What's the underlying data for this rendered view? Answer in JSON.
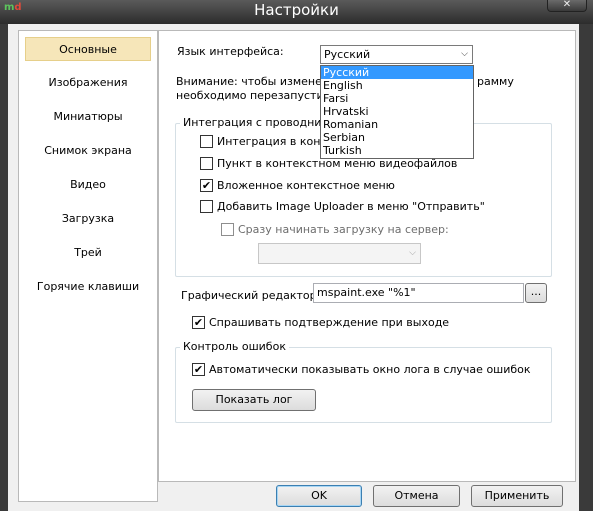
{
  "window": {
    "title": "Настройки",
    "close_glyph": "✕"
  },
  "sidebar": {
    "items": [
      {
        "label": "Основные",
        "active": true
      },
      {
        "label": "Изображения"
      },
      {
        "label": "Миниатюры"
      },
      {
        "label": "Снимок экрана"
      },
      {
        "label": "Видео"
      },
      {
        "label": "Загрузка"
      },
      {
        "label": "Трей"
      },
      {
        "label": "Горячие клавиши"
      }
    ]
  },
  "general": {
    "language_label": "Язык интерфейса:",
    "language_selected": "Русский",
    "language_options": [
      "Русский",
      "English",
      "Farsi",
      "Hrvatski",
      "Romanian",
      "Serbian",
      "Turkish"
    ],
    "warning_line1": "Внимание: чтобы изменения",
    "warning_line1_end": "рамму",
    "warning_line2": "необходимо перезапустить.",
    "explorer_group_title": "Интеграция с проводником",
    "explorer_integration": {
      "label": "Интеграция в контексте",
      "checked": false
    },
    "video_menu_item": {
      "label": "Пункт в контекстном меню видеофайлов",
      "checked": false
    },
    "nested_menu": {
      "label": "Вложенное контекстное меню",
      "checked": true
    },
    "sendto_menu": {
      "label": "Добавить Image Uploader в меню \"Отправить\"",
      "checked": false
    },
    "upload_immediately": {
      "label": "Сразу начинать загрузку на сервер:",
      "checked": false
    },
    "server_select_value": "",
    "editor_label": "Графический редактор:",
    "editor_value": "mspaint.exe \"%1\"",
    "browse_label": "...",
    "confirm_exit": {
      "label": "Спрашивать подтверждение при выходе",
      "checked": true
    },
    "errors_group_title": "Контроль ошибок",
    "auto_show_log": {
      "label": "Автоматически показывать окно лога в случае ошибок",
      "checked": true
    },
    "show_log_button": "Показать лог"
  },
  "footer": {
    "ok": "OK",
    "cancel": "Отмена",
    "apply": "Применить"
  },
  "colors": {
    "active_item_bg": "#f6e6b9",
    "selection": "#3399ff",
    "frame": "#3a3a3a"
  }
}
